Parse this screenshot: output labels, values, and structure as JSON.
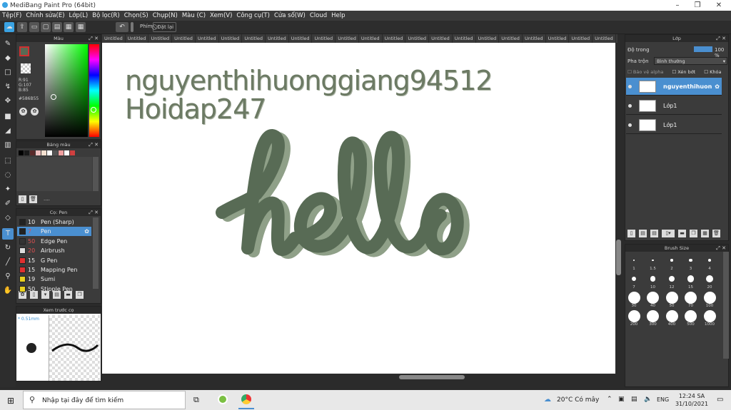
{
  "window": {
    "title": "MediBang Paint Pro (64bit)"
  },
  "menu": [
    "Tệp(F)",
    "Chỉnh sửa(E)",
    "Lớp(L)",
    "Bộ lọc(R)",
    "Chọn(S)",
    "Chụp(N)",
    "Màu (C)",
    "Xem(V)",
    "Công cụ(T)",
    "Cửa sổ(W)",
    "Cloud",
    "Help"
  ],
  "toolbar": {
    "key_label": "Phím",
    "reset_label": "Đặt lại"
  },
  "color_panel": {
    "title": "Màu",
    "r": "R:91",
    "g": "G:107",
    "b": "B:85",
    "hex": "#586B55",
    "fg": "#586B55",
    "bg": "#ffffff"
  },
  "palette_panel": {
    "title": "Bảng màu",
    "colors": [
      "#000000",
      "#1a1a1a",
      "#5a2a2a",
      "#f0c0c0",
      "#f5e0d0",
      "#ffffff",
      "#555555",
      "#f0a0a0",
      "#ffffff",
      "#d04040"
    ],
    "dots": "...."
  },
  "brush_panel": {
    "title": "Cọ: Pen",
    "items": [
      {
        "size": "10",
        "name": "Pen (Sharp)",
        "color": "#222222",
        "red": false
      },
      {
        "size": "7",
        "name": "Pen",
        "color": "#222222",
        "red": true
      },
      {
        "size": "50",
        "name": "Edge Pen",
        "color": "#333333",
        "red": true
      },
      {
        "size": "20",
        "name": "Airbrush",
        "color": "#dddddd",
        "red": true
      },
      {
        "size": "15",
        "name": "G Pen",
        "color": "#e03030",
        "red": false
      },
      {
        "size": "15",
        "name": "Mapping Pen",
        "color": "#e03030",
        "red": false
      },
      {
        "size": "19",
        "name": "Sumi",
        "color": "#e8d020",
        "red": false
      },
      {
        "size": "50",
        "name": "Stipple Pen",
        "color": "#e8d020",
        "red": false
      }
    ]
  },
  "preview_panel": {
    "title": "Xem trước cọ",
    "size": "0.51mm"
  },
  "tabs": [
    "Untitled",
    "Untitled",
    "Untitled",
    "Untitled",
    "Untitled",
    "Untitled",
    "Untitled",
    "Untitled",
    "Untitled",
    "Untitled",
    "Untitled",
    "Untitled",
    "Untitled",
    "Untitled",
    "Untitled",
    "Untitled",
    "Untitled",
    "Untitled",
    "Untitled",
    "Untitled",
    "Untitled",
    "Untitled",
    "Untitled",
    "Untitled"
  ],
  "canvas": {
    "line1": "nguyenthihuonggiang94512",
    "line2": "Hoidap247",
    "art": "hello",
    "ink": "#586B55",
    "shadow": "#8fa088"
  },
  "layer_panel": {
    "title": "Lớp",
    "opacity_label": "Độ trong",
    "opacity_value": "100 %",
    "opacity": 1.0,
    "blend_label": "Pha trộn",
    "blend_value": "Bình thường",
    "protect_alpha": "Bảo vệ alpha",
    "clip": "Xén bớt",
    "lock": "Khóa",
    "layers": [
      {
        "name": "nguyenthihuon",
        "selected": true
      },
      {
        "name": "Lớp1",
        "selected": false
      },
      {
        "name": "Lớp1",
        "selected": false
      }
    ]
  },
  "brush_size_panel": {
    "title": "Brush Size",
    "sizes": [
      "1",
      "1.5",
      "2",
      "3",
      "4",
      "7",
      "10",
      "12",
      "15",
      "20",
      "30",
      "40",
      "50",
      "70",
      "100",
      "200",
      "300",
      "400",
      "500",
      "1000"
    ]
  },
  "taskbar": {
    "search_placeholder": "Nhập tại đây để tìm kiếm",
    "weather": "20°C Có mây",
    "lang": "ENG",
    "time": "12:24 SA",
    "date": "31/10/2021"
  }
}
